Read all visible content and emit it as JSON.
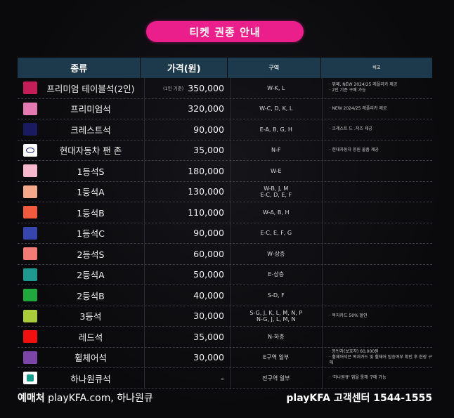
{
  "title": "티켓 권종 안내",
  "table": {
    "headers": [
      "종류",
      "가격(원)",
      "구역",
      "비고"
    ],
    "rows": [
      {
        "color": "#c41d58",
        "name": "프리미엄 테이블석(2인)",
        "basis": "(1인 기준)",
        "price": "350,000",
        "zones": [
          "W-K, L"
        ],
        "notes": [
          "· 뷔페, NEW 2024/25 레플리카 제공",
          "· 2인 기준 구매 가능"
        ]
      },
      {
        "color": "#e47ab1",
        "name": "프리미엄석",
        "basis": "",
        "price": "320,000",
        "zones": [
          "W-C, D, K, L"
        ],
        "notes": [
          "· NEW 2024/25 레플리카 제공"
        ]
      },
      {
        "color": "#1a1a60",
        "name": "크레스트석",
        "basis": "",
        "price": "90,000",
        "zones": [
          "E-A, B, G, H"
        ],
        "notes": [
          "· 크레스트 드 .저즈 제공"
        ]
      },
      {
        "color": "#ffffff",
        "icon": "hyundai-logo-icon",
        "name": "현대자동차 팬 존",
        "basis": "",
        "price": "35,000",
        "zones": [
          "N-F"
        ],
        "notes": [
          "· 현대자동차 응원 물품 제공"
        ]
      },
      {
        "color": "#f7b7cc",
        "name": "1등석S",
        "basis": "",
        "price": "180,000",
        "zones": [
          "W-E"
        ],
        "notes": []
      },
      {
        "color": "#f6a98a",
        "name": "1등석A",
        "basis": "",
        "price": "130,000",
        "zones": [
          "W-B, J, M",
          "E-C, D, E, F"
        ],
        "notes": []
      },
      {
        "color": "#f25a3e",
        "name": "1등석B",
        "basis": "",
        "price": "110,000",
        "zones": [
          "W-A, B, H"
        ],
        "notes": []
      },
      {
        "color": "#3646ad",
        "name": "1등석C",
        "basis": "",
        "price": "90,000",
        "zones": [
          "E-C, E, F, G"
        ],
        "notes": []
      },
      {
        "color": "#f27b75",
        "name": "2등석S",
        "basis": "",
        "price": "60,000",
        "zones": [
          "W-상층"
        ],
        "notes": []
      },
      {
        "color": "#1f9990",
        "name": "2등석A",
        "basis": "",
        "price": "50,000",
        "zones": [
          "E-상층"
        ],
        "notes": []
      },
      {
        "color": "#20a83c",
        "name": "2등석B",
        "basis": "",
        "price": "40,000",
        "zones": [
          "S-D, F"
        ],
        "notes": []
      },
      {
        "color": "#a8cc3a",
        "name": "3등석",
        "basis": "",
        "price": "30,000",
        "zones": [
          "S-G, J, K, L, M, N, P",
          "N-G, J, L, M, N"
        ],
        "notes": [
          "· 복지카드 50% 할인"
        ]
      },
      {
        "color": "#f01010",
        "name": "레드석",
        "basis": "",
        "price": "35,000",
        "zones": [
          "N-하층"
        ],
        "notes": []
      },
      {
        "color": "#7c46a8",
        "name": "휠체어석",
        "basis": "",
        "price": "30,000",
        "zones": [
          "E구역 일부"
        ],
        "notes": [
          "· 동반자(보호자) 60,000원",
          "· 휠체어석은 복지카드 및 휠체어 탑승여부 확인 후 현장 구매"
        ]
      },
      {
        "color": "#ffffff",
        "icon": "hana-logo-icon",
        "name": "하나원큐석",
        "basis": "",
        "price": "-",
        "zones": [
          "전구역 일부"
        ],
        "notes": [
          "· '하나원큐' 앱을 통해 구매 가능"
        ]
      }
    ]
  },
  "footer": {
    "left_label": "예매처",
    "left_text": "playKFA.com, 하나원큐",
    "right_text": "playKFA 고객센터 1544-1555"
  }
}
